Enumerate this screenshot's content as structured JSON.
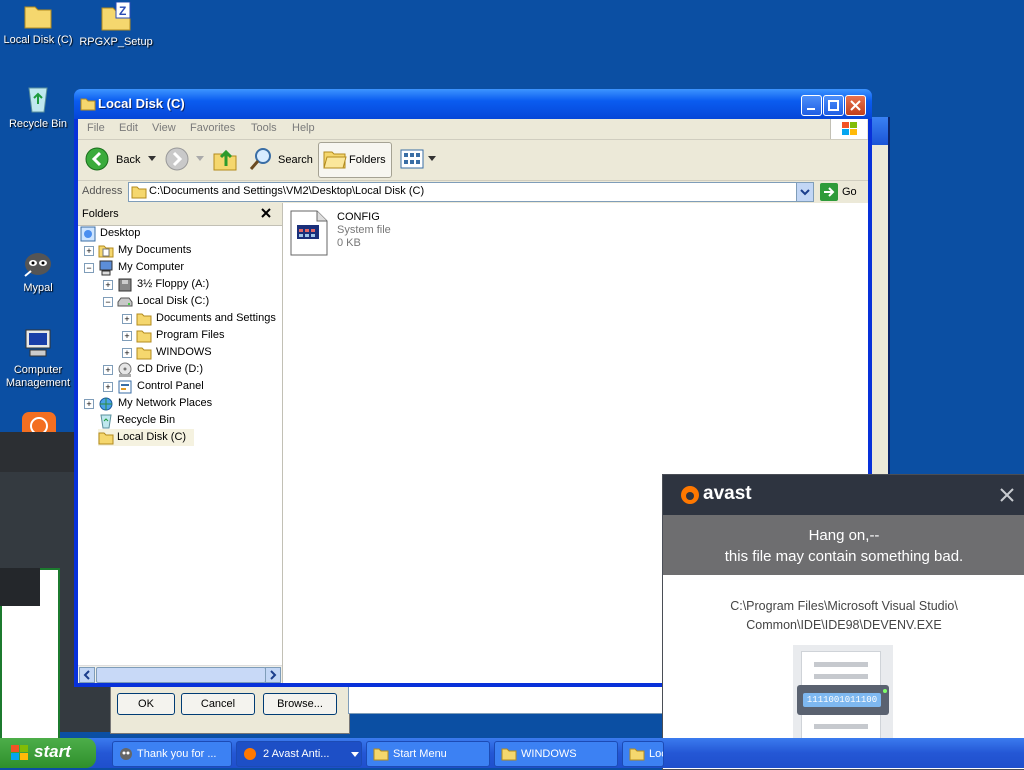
{
  "desktop": {
    "icons": [
      {
        "label": "Local Disk (C)"
      },
      {
        "label": "RPGXP_Setup"
      },
      {
        "label": "Recycle Bin"
      },
      {
        "label": "Mypal"
      },
      {
        "label": "Computer Management"
      }
    ]
  },
  "window": {
    "title": "Local Disk (C)",
    "menu": [
      "File",
      "Edit",
      "View",
      "Favorites",
      "Tools",
      "Help"
    ],
    "toolbar": {
      "back": "Back",
      "search": "Search",
      "folders": "Folders"
    },
    "address": {
      "label": "Address",
      "value": "C:\\Documents and Settings\\VM2\\Desktop\\Local Disk (C)",
      "go": "Go"
    },
    "folders_pane": {
      "title": "Folders",
      "tree": [
        {
          "label": "Desktop"
        },
        {
          "label": "My Documents"
        },
        {
          "label": "My Computer"
        },
        {
          "label": "3½ Floppy (A:)"
        },
        {
          "label": "Local Disk (C:)"
        },
        {
          "label": "Documents and Settings"
        },
        {
          "label": "Program Files"
        },
        {
          "label": "WINDOWS"
        },
        {
          "label": "CD Drive (D:)"
        },
        {
          "label": "Control Panel"
        },
        {
          "label": "My Network Places"
        },
        {
          "label": "Recycle Bin"
        },
        {
          "label": "Local Disk (C)"
        }
      ]
    },
    "files": [
      {
        "name": "CONFIG",
        "type": "System file",
        "size": "0 KB"
      }
    ]
  },
  "behind_dialog": {
    "ok": "OK",
    "cancel": "Cancel",
    "browse": "Browse..."
  },
  "avast": {
    "brand": "avast",
    "line1": "Hang on,--",
    "line2": "this file may contain something bad.",
    "path1": "C:\\Program Files\\Microsoft Visual Studio\\",
    "path2": "Common\\IDE\\IDE98\\DEVENV.EXE",
    "binary": "1111001011100",
    "colors": {
      "header": "#2e3440",
      "accent": "#ff7800",
      "band": "#6e6e70"
    }
  },
  "taskbar": {
    "start": "start",
    "tasks": [
      {
        "label": "Thank you for ..."
      },
      {
        "label": "2 Avast Anti..."
      },
      {
        "label": "Start Menu"
      },
      {
        "label": "WINDOWS"
      },
      {
        "label": "Loc"
      }
    ]
  }
}
